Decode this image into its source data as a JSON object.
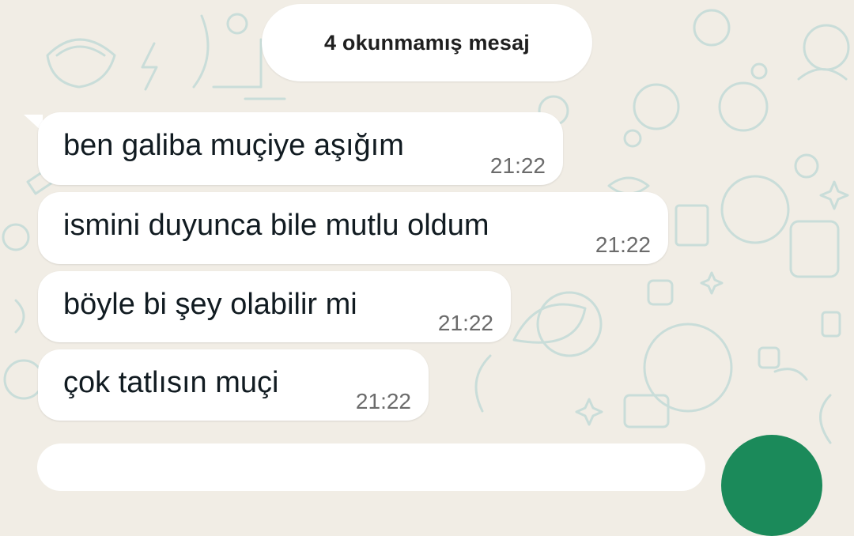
{
  "colors": {
    "background": "#f1ede5",
    "bubble": "#ffffff",
    "doodle": "#c7dcd8",
    "fab": "#1b8a5a"
  },
  "unread_banner": {
    "label": "4 okunmamış mesaj"
  },
  "messages": [
    {
      "text": "ben galiba muçiye aşığım",
      "time": "21:22"
    },
    {
      "text": "ismini duyunca bile mutlu oldum",
      "time": "21:22"
    },
    {
      "text": "böyle bi şey olabilir mi",
      "time": "21:22"
    },
    {
      "text": "çok tatlısın muçi",
      "time": "21:22"
    }
  ]
}
